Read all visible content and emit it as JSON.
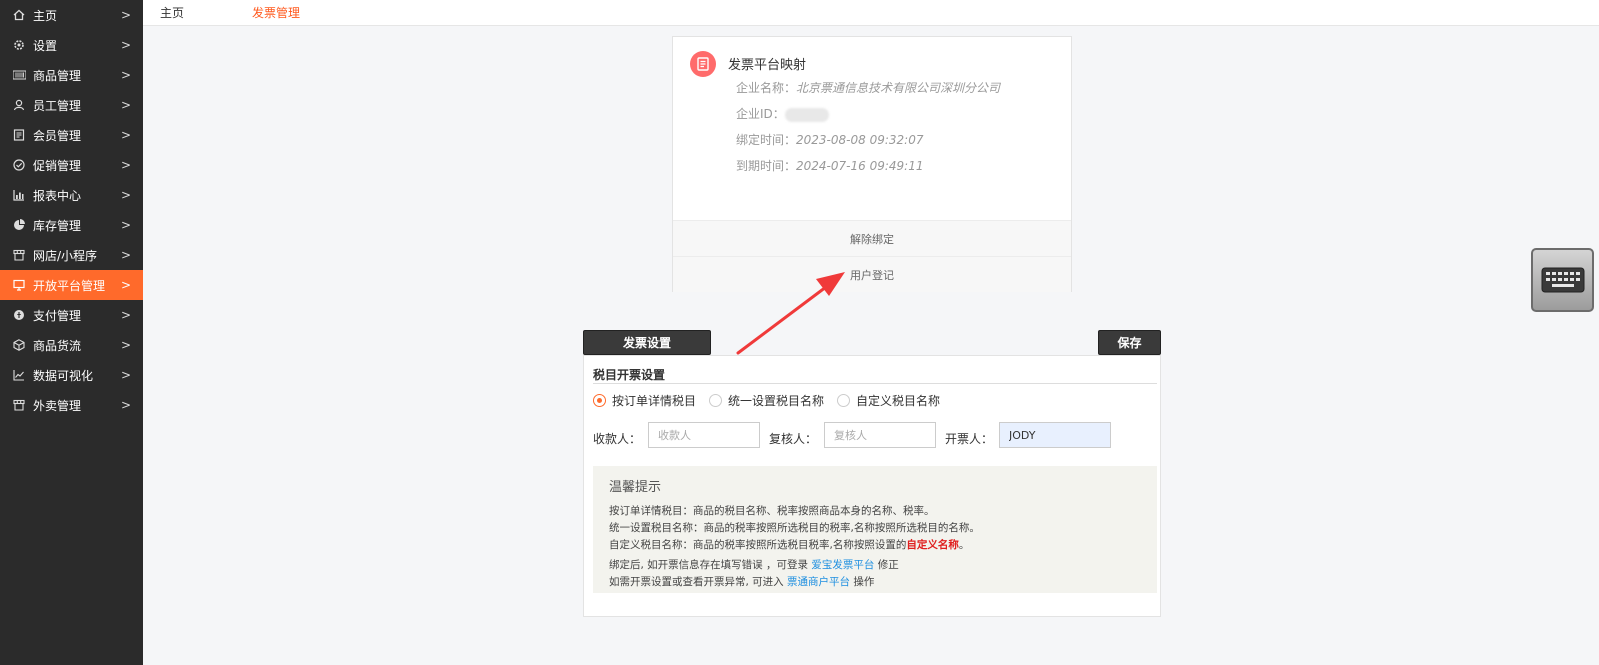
{
  "sidebar": {
    "items": [
      {
        "label": "主页",
        "icon": "home-icon",
        "active": false
      },
      {
        "label": "设置",
        "icon": "gear-icon",
        "active": false
      },
      {
        "label": "商品管理",
        "icon": "barcode-icon",
        "active": false
      },
      {
        "label": "员工管理",
        "icon": "user-icon",
        "active": false
      },
      {
        "label": "会员管理",
        "icon": "member-card-icon",
        "active": false
      },
      {
        "label": "促销管理",
        "icon": "check-circle-icon",
        "active": false
      },
      {
        "label": "报表中心",
        "icon": "bar-chart-icon",
        "active": false
      },
      {
        "label": "库存管理",
        "icon": "pie-chart-icon",
        "active": false
      },
      {
        "label": "网店/小程序",
        "icon": "store-icon",
        "active": false
      },
      {
        "label": "开放平台管理",
        "icon": "monitor-icon",
        "active": true
      },
      {
        "label": "支付管理",
        "icon": "coin-icon",
        "active": false
      },
      {
        "label": "商品货流",
        "icon": "cube-icon",
        "active": false
      },
      {
        "label": "数据可视化",
        "icon": "line-chart-icon",
        "active": false
      },
      {
        "label": "外卖管理",
        "icon": "store-icon",
        "active": false
      }
    ],
    "chevron": ">"
  },
  "breadcrumb": {
    "home": "主页",
    "current": "发票管理"
  },
  "card": {
    "title": "发票平台映射",
    "company_name_label": "企业名称：",
    "company_name": "北京票通信息技术有限公司深圳分公司",
    "company_id_label": "企业ID：",
    "bind_time_label": "绑定时间：",
    "bind_time": "2023-08-08 09:32:07",
    "expire_time_label": "到期时间：",
    "expire_time": "2024-07-16 09:49:11",
    "unbind_label": "解除绑定",
    "register_label": "用户登记"
  },
  "invoice": {
    "settings_button": "发票设置",
    "save_button": "保存",
    "section_title": "税目开票设置",
    "radio_options": [
      {
        "label": "按订单详情税目",
        "checked": true
      },
      {
        "label": "统一设置税目名称",
        "checked": false
      },
      {
        "label": "自定义税目名称",
        "checked": false
      }
    ],
    "payee_label": "收款人：",
    "payee_placeholder": "收款人",
    "reviewer_label": "复核人：",
    "reviewer_placeholder": "复核人",
    "drawer_label": "开票人：",
    "drawer_value": "JODY"
  },
  "tips": {
    "title": "温馨提示",
    "line1": "按订单详情税目：商品的税目名称、税率按照商品本身的名称、税率。",
    "line2": "统一设置税目名称：商品的税率按照所选税目的税率,名称按照所选税目的名称。",
    "line3_prefix": "自定义税目名称：商品的税率按照所选税目税率,名称按照设置的",
    "line3_highlight": "自定义名称",
    "line3_suffix": "。",
    "line4_prefix": "绑定后, 如开票信息存在填写错误 ，可登录",
    "line4_link": "爱宝发票平台",
    "line4_suffix": "修正",
    "line5_prefix": "如需开票设置或查看开票异常, 可进入",
    "line5_link": "票通商户平台",
    "line5_suffix": "操作"
  },
  "colors": {
    "accent": "#ff6a2b",
    "sidebar_bg": "#2b2b2b",
    "link": "#1e8fe0",
    "highlight_red": "#e02020",
    "arrow": "#f03a3a"
  }
}
